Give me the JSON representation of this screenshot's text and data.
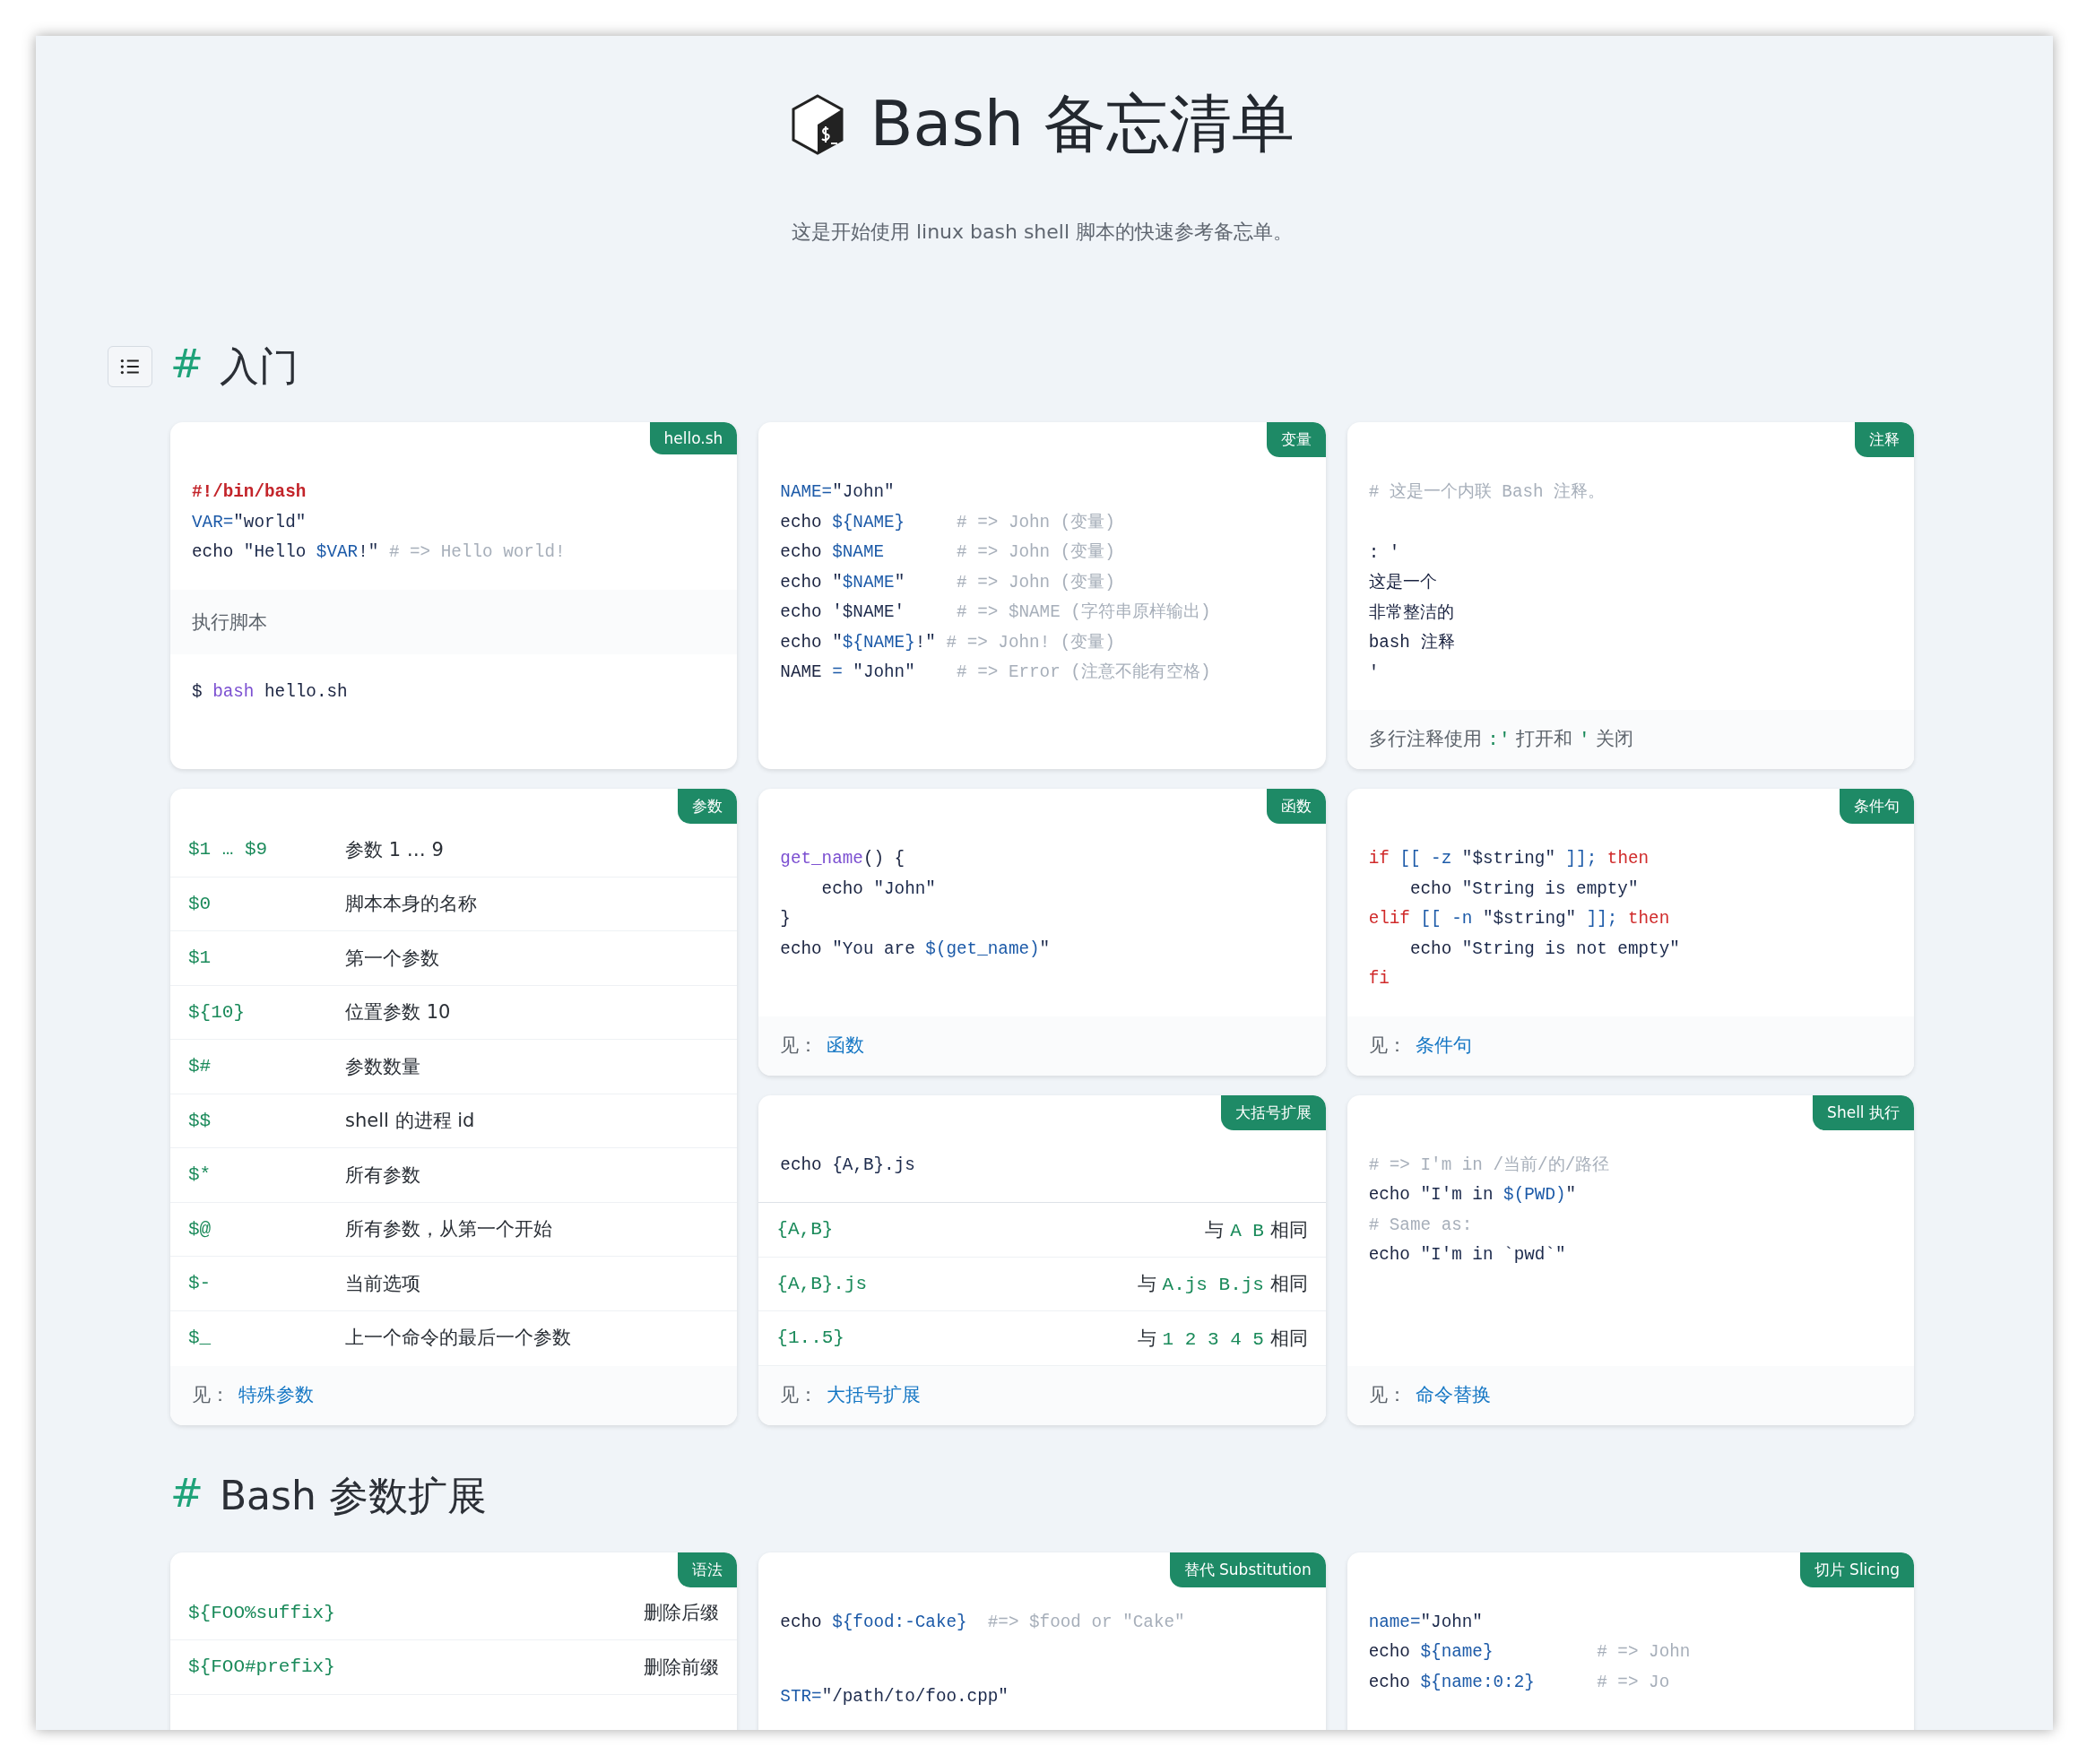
{
  "header": {
    "title": "Bash 备忘清单",
    "subtitle": "这是开始使用 linux bash shell 脚本的快速参考备忘单。"
  },
  "sections": [
    {
      "mark": "#",
      "title": "入门",
      "toc_button": true,
      "cards": [
        {
          "tag": "hello.sh",
          "tall": false,
          "blocks": [
            {
              "kind": "code",
              "lines": [
                [
                  {
                    "kind": "shebang",
                    "text": "#!/bin/bash"
                  }
                ],
                [
                  {
                    "kind": "var",
                    "text": "VAR="
                  },
                  {
                    "kind": "str",
                    "text": "\"world\""
                  }
                ],
                [
                  {
                    "kind": "plain",
                    "text": "echo "
                  },
                  {
                    "kind": "str",
                    "text": "\"Hello "
                  },
                  {
                    "kind": "var",
                    "text": "$VAR"
                  },
                  {
                    "kind": "str",
                    "text": "!\" "
                  },
                  {
                    "kind": "com",
                    "text": "# => Hello world!"
                  }
                ]
              ]
            },
            {
              "kind": "note",
              "parts": [
                {
                  "kind": "text",
                  "text": "执行脚本"
                }
              ]
            },
            {
              "kind": "code",
              "lines": [
                [
                  {
                    "kind": "plain",
                    "text": "$ "
                  },
                  {
                    "kind": "fn",
                    "text": "bash"
                  },
                  {
                    "kind": "plain",
                    "text": " hello.sh"
                  }
                ]
              ]
            }
          ]
        },
        {
          "tag": "变量",
          "tall": false,
          "blocks": [
            {
              "kind": "code",
              "lines": [
                [
                  {
                    "kind": "var",
                    "text": "NAME="
                  },
                  {
                    "kind": "str",
                    "text": "\"John\""
                  }
                ],
                [
                  {
                    "kind": "plain",
                    "text": "echo "
                  },
                  {
                    "kind": "var",
                    "text": "${NAME}"
                  },
                  {
                    "kind": "com",
                    "text": "     # => John (变量)"
                  }
                ],
                [
                  {
                    "kind": "plain",
                    "text": "echo "
                  },
                  {
                    "kind": "var",
                    "text": "$NAME"
                  },
                  {
                    "kind": "com",
                    "text": "       # => John (变量)"
                  }
                ],
                [
                  {
                    "kind": "plain",
                    "text": "echo "
                  },
                  {
                    "kind": "str",
                    "text": "\""
                  },
                  {
                    "kind": "var",
                    "text": "$NAME"
                  },
                  {
                    "kind": "str",
                    "text": "\""
                  },
                  {
                    "kind": "com",
                    "text": "     # => John (变量)"
                  }
                ],
                [
                  {
                    "kind": "plain",
                    "text": "echo "
                  },
                  {
                    "kind": "str",
                    "text": "'$NAME'"
                  },
                  {
                    "kind": "com",
                    "text": "     # => $NAME (字符串原样输出)"
                  }
                ],
                [
                  {
                    "kind": "plain",
                    "text": "echo "
                  },
                  {
                    "kind": "str",
                    "text": "\""
                  },
                  {
                    "kind": "var",
                    "text": "${NAME}"
                  },
                  {
                    "kind": "str",
                    "text": "!\""
                  },
                  {
                    "kind": "com",
                    "text": " # => John! (变量)"
                  }
                ],
                [
                  {
                    "kind": "plain",
                    "text": "NAME "
                  },
                  {
                    "kind": "var",
                    "text": "="
                  },
                  {
                    "kind": "str",
                    "text": " \"John\""
                  },
                  {
                    "kind": "com",
                    "text": "    # => Error (注意不能有空格)"
                  }
                ]
              ]
            }
          ]
        },
        {
          "tag": "注释",
          "tall": false,
          "blocks": [
            {
              "kind": "code",
              "lines": [
                [
                  {
                    "kind": "com",
                    "text": "# 这是一个内联 Bash 注释。"
                  }
                ]
              ]
            },
            {
              "kind": "code",
              "lines": [
                [
                  {
                    "kind": "plain",
                    "text": ": '"
                  }
                ],
                [
                  {
                    "kind": "plain",
                    "text": "这是一个"
                  }
                ],
                [
                  {
                    "kind": "plain",
                    "text": "非常整洁的"
                  }
                ],
                [
                  {
                    "kind": "plain",
                    "text": "bash 注释"
                  }
                ],
                [
                  {
                    "kind": "plain",
                    "text": "'"
                  }
                ]
              ]
            },
            {
              "kind": "footnote",
              "parts": [
                {
                  "kind": "text",
                  "text": "多行注释使用 "
                },
                {
                  "kind": "code",
                  "text": ":'"
                },
                {
                  "kind": "text",
                  "text": " 打开和 "
                },
                {
                  "kind": "code",
                  "text": "'"
                },
                {
                  "kind": "text",
                  "text": " 关闭"
                }
              ]
            }
          ]
        },
        {
          "tag": "参数",
          "tall": true,
          "blocks": [
            {
              "kind": "table",
              "rows": [
                {
                  "key": "$1 … $9",
                  "value": "参数 1 … 9"
                },
                {
                  "key": "$0",
                  "value": "脚本本身的名称"
                },
                {
                  "key": "$1",
                  "value": "第一个参数"
                },
                {
                  "key": "${10}",
                  "value": "位置参数 10"
                },
                {
                  "key": "$#",
                  "value": "参数数量"
                },
                {
                  "key": "$$",
                  "value": "shell 的进程 id"
                },
                {
                  "key": "$*",
                  "value": "所有参数"
                },
                {
                  "key": "$@",
                  "value": "所有参数，从第一个开始"
                },
                {
                  "key": "$-",
                  "value": "当前选项"
                },
                {
                  "key": "$_",
                  "value": "上一个命令的最后一个参数"
                }
              ]
            },
            {
              "kind": "see",
              "prefix": "见：",
              "link": "特殊参数"
            }
          ]
        },
        {
          "tag": "函数",
          "tall": false,
          "blocks": [
            {
              "kind": "code",
              "lines": [
                [
                  {
                    "kind": "fn",
                    "text": "get_name"
                  },
                  {
                    "kind": "plain",
                    "text": "() {"
                  }
                ],
                [
                  {
                    "kind": "plain",
                    "text": "    echo "
                  },
                  {
                    "kind": "str",
                    "text": "\"John\""
                  }
                ],
                [
                  {
                    "kind": "plain",
                    "text": "}"
                  }
                ],
                [
                  {
                    "kind": "plain",
                    "text": "echo "
                  },
                  {
                    "kind": "str",
                    "text": "\"You are "
                  },
                  {
                    "kind": "var",
                    "text": "$(get_name)"
                  },
                  {
                    "kind": "str",
                    "text": "\""
                  }
                ]
              ]
            },
            {
              "kind": "see",
              "prefix": "见：",
              "link": "函数"
            }
          ]
        },
        {
          "tag": "条件句",
          "tall": false,
          "blocks": [
            {
              "kind": "code",
              "lines": [
                [
                  {
                    "kind": "kw",
                    "text": "if"
                  },
                  {
                    "kind": "var",
                    "text": " [[ -z "
                  },
                  {
                    "kind": "str",
                    "text": "\"$string\""
                  },
                  {
                    "kind": "var",
                    "text": " ]]; "
                  },
                  {
                    "kind": "kw",
                    "text": "then"
                  }
                ],
                [
                  {
                    "kind": "plain",
                    "text": "    echo "
                  },
                  {
                    "kind": "str",
                    "text": "\"String is empty\""
                  }
                ],
                [
                  {
                    "kind": "kw",
                    "text": "elif"
                  },
                  {
                    "kind": "var",
                    "text": " [[ -n "
                  },
                  {
                    "kind": "str",
                    "text": "\"$string\""
                  },
                  {
                    "kind": "var",
                    "text": " ]]; "
                  },
                  {
                    "kind": "kw",
                    "text": "then"
                  }
                ],
                [
                  {
                    "kind": "plain",
                    "text": "    echo "
                  },
                  {
                    "kind": "str",
                    "text": "\"String is not empty\""
                  }
                ],
                [
                  {
                    "kind": "kw",
                    "text": "fi"
                  }
                ]
              ]
            },
            {
              "kind": "see",
              "prefix": "见：",
              "link": "条件句"
            }
          ]
        },
        {
          "tag": "大括号扩展",
          "tall": false,
          "blocks": [
            {
              "kind": "code",
              "lines": [
                [
                  {
                    "kind": "plain",
                    "text": "echo "
                  },
                  {
                    "kind": "str",
                    "text": "{A,B}.js"
                  }
                ]
              ]
            },
            {
              "kind": "pairs",
              "rows": [
                {
                  "key": "{A,B}",
                  "value": [
                    {
                      "kind": "text",
                      "text": "与 "
                    },
                    {
                      "kind": "code",
                      "text": "A B"
                    },
                    {
                      "kind": "text",
                      "text": " 相同"
                    }
                  ]
                },
                {
                  "key": "{A,B}.js",
                  "value": [
                    {
                      "kind": "text",
                      "text": "与 "
                    },
                    {
                      "kind": "code",
                      "text": "A.js B.js"
                    },
                    {
                      "kind": "text",
                      "text": " 相同"
                    }
                  ]
                },
                {
                  "key": "{1..5}",
                  "value": [
                    {
                      "kind": "text",
                      "text": "与 "
                    },
                    {
                      "kind": "code",
                      "text": "1 2 3 4 5"
                    },
                    {
                      "kind": "text",
                      "text": " 相同"
                    }
                  ]
                }
              ]
            },
            {
              "kind": "see",
              "prefix": "见：",
              "link": "大括号扩展"
            }
          ]
        },
        {
          "tag": "Shell 执行",
          "tall": false,
          "blocks": [
            {
              "kind": "code",
              "lines": [
                [
                  {
                    "kind": "com",
                    "text": "# => I'm in /当前/的/路径"
                  }
                ],
                [
                  {
                    "kind": "plain",
                    "text": "echo "
                  },
                  {
                    "kind": "str",
                    "text": "\"I'm in "
                  },
                  {
                    "kind": "var",
                    "text": "$(PWD)"
                  },
                  {
                    "kind": "str",
                    "text": "\""
                  }
                ],
                [
                  {
                    "kind": "com",
                    "text": "# Same as:"
                  }
                ],
                [
                  {
                    "kind": "plain",
                    "text": "echo "
                  },
                  {
                    "kind": "str",
                    "text": "\"I'm in `pwd`\""
                  }
                ]
              ]
            },
            {
              "kind": "see",
              "prefix": "见：",
              "link": "命令替换"
            }
          ]
        }
      ]
    },
    {
      "mark": "#",
      "title": "Bash 参数扩展",
      "toc_button": false,
      "cards": [
        {
          "tag": "语法",
          "tall": false,
          "blocks": [
            {
              "kind": "pairs",
              "rows": [
                {
                  "key": "${FOO%suffix}",
                  "value": "删除后缀"
                },
                {
                  "key": "${FOO#prefix}",
                  "value": "删除前缀"
                }
              ]
            }
          ]
        },
        {
          "tag": "替代 Substitution",
          "tall": false,
          "blocks": [
            {
              "kind": "code",
              "lines": [
                [
                  {
                    "kind": "plain",
                    "text": "echo "
                  },
                  {
                    "kind": "var",
                    "text": "${food:-Cake}"
                  },
                  {
                    "kind": "com",
                    "text": "  #=> $food or \"Cake\""
                  }
                ]
              ]
            },
            {
              "kind": "code",
              "lines": [
                [
                  {
                    "kind": "var",
                    "text": "STR="
                  },
                  {
                    "kind": "str",
                    "text": "\"/path/to/foo.cpp\""
                  }
                ]
              ]
            }
          ]
        },
        {
          "tag": "切片 Slicing",
          "tall": false,
          "blocks": [
            {
              "kind": "code",
              "lines": [
                [
                  {
                    "kind": "var",
                    "text": "name="
                  },
                  {
                    "kind": "str",
                    "text": "\"John\""
                  }
                ],
                [
                  {
                    "kind": "plain",
                    "text": "echo "
                  },
                  {
                    "kind": "var",
                    "text": "${name}"
                  },
                  {
                    "kind": "com",
                    "text": "          # => John"
                  }
                ],
                [
                  {
                    "kind": "plain",
                    "text": "echo "
                  },
                  {
                    "kind": "var",
                    "text": "${name:0:2}"
                  },
                  {
                    "kind": "com",
                    "text": "      # => Jo"
                  }
                ]
              ]
            }
          ]
        }
      ]
    }
  ]
}
